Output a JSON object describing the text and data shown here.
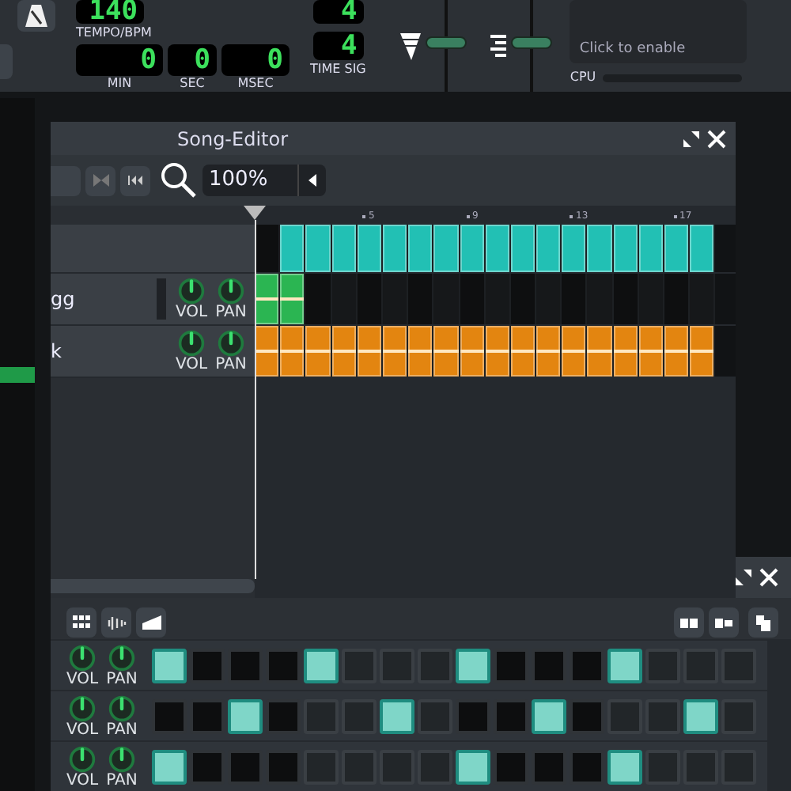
{
  "toolbar": {
    "tempo": {
      "value": "140",
      "label": "TEMPO/BPM"
    },
    "time": [
      {
        "value": "0",
        "label": "MIN"
      },
      {
        "value": "0",
        "label": "SEC"
      },
      {
        "value": "0",
        "label": "MSEC"
      }
    ],
    "time_sig": {
      "numerator": "4",
      "denominator": "4",
      "label": "TIME SIG"
    },
    "master_volume": {
      "level": 0.55
    },
    "master_pitch": {
      "level": 0.55
    },
    "cpu": {
      "hint": "Click to enable",
      "label": "CPU"
    }
  },
  "song_editor": {
    "title": "Song-Editor",
    "zoom": "100%",
    "ruler": [
      "5",
      "9",
      "13",
      "17"
    ],
    "tracks": [
      {
        "color": "#22c0b4",
        "cells": [
          false,
          true,
          true,
          true,
          true,
          true,
          true,
          true,
          true,
          true,
          true,
          true,
          true,
          true,
          true,
          true,
          true,
          true
        ]
      },
      {
        "name": "gg",
        "color": "#2bb552",
        "knobs": [
          {
            "label": "VOL"
          },
          {
            "label": "PAN"
          }
        ],
        "cells": [
          true,
          true,
          false,
          false,
          false,
          false,
          false,
          false,
          false,
          false,
          false,
          false,
          false,
          false,
          false,
          false,
          false,
          false
        ]
      },
      {
        "name": "k",
        "color": "#e38510",
        "knobs": [
          {
            "label": "VOL"
          },
          {
            "label": "PAN"
          }
        ],
        "cells": [
          true,
          true,
          true,
          true,
          true,
          true,
          true,
          true,
          true,
          true,
          true,
          true,
          true,
          true,
          true,
          true,
          true,
          true
        ]
      }
    ]
  },
  "beat_editor": {
    "rows": [
      {
        "knobs": [
          {
            "label": "VOL"
          },
          {
            "label": "PAN"
          }
        ],
        "steps": [
          true,
          false,
          false,
          false,
          true,
          false,
          false,
          false,
          true,
          false,
          false,
          false,
          true,
          false,
          false,
          false
        ]
      },
      {
        "knobs": [
          {
            "label": "VOL"
          },
          {
            "label": "PAN"
          }
        ],
        "steps": [
          false,
          false,
          true,
          false,
          false,
          false,
          true,
          false,
          false,
          false,
          true,
          false,
          false,
          false,
          true,
          false
        ]
      },
      {
        "knobs": [
          {
            "label": "VOL"
          },
          {
            "label": "PAN"
          }
        ],
        "steps": [
          true,
          false,
          false,
          false,
          false,
          false,
          false,
          false,
          true,
          false,
          false,
          false,
          true,
          false,
          false,
          false
        ]
      }
    ]
  }
}
